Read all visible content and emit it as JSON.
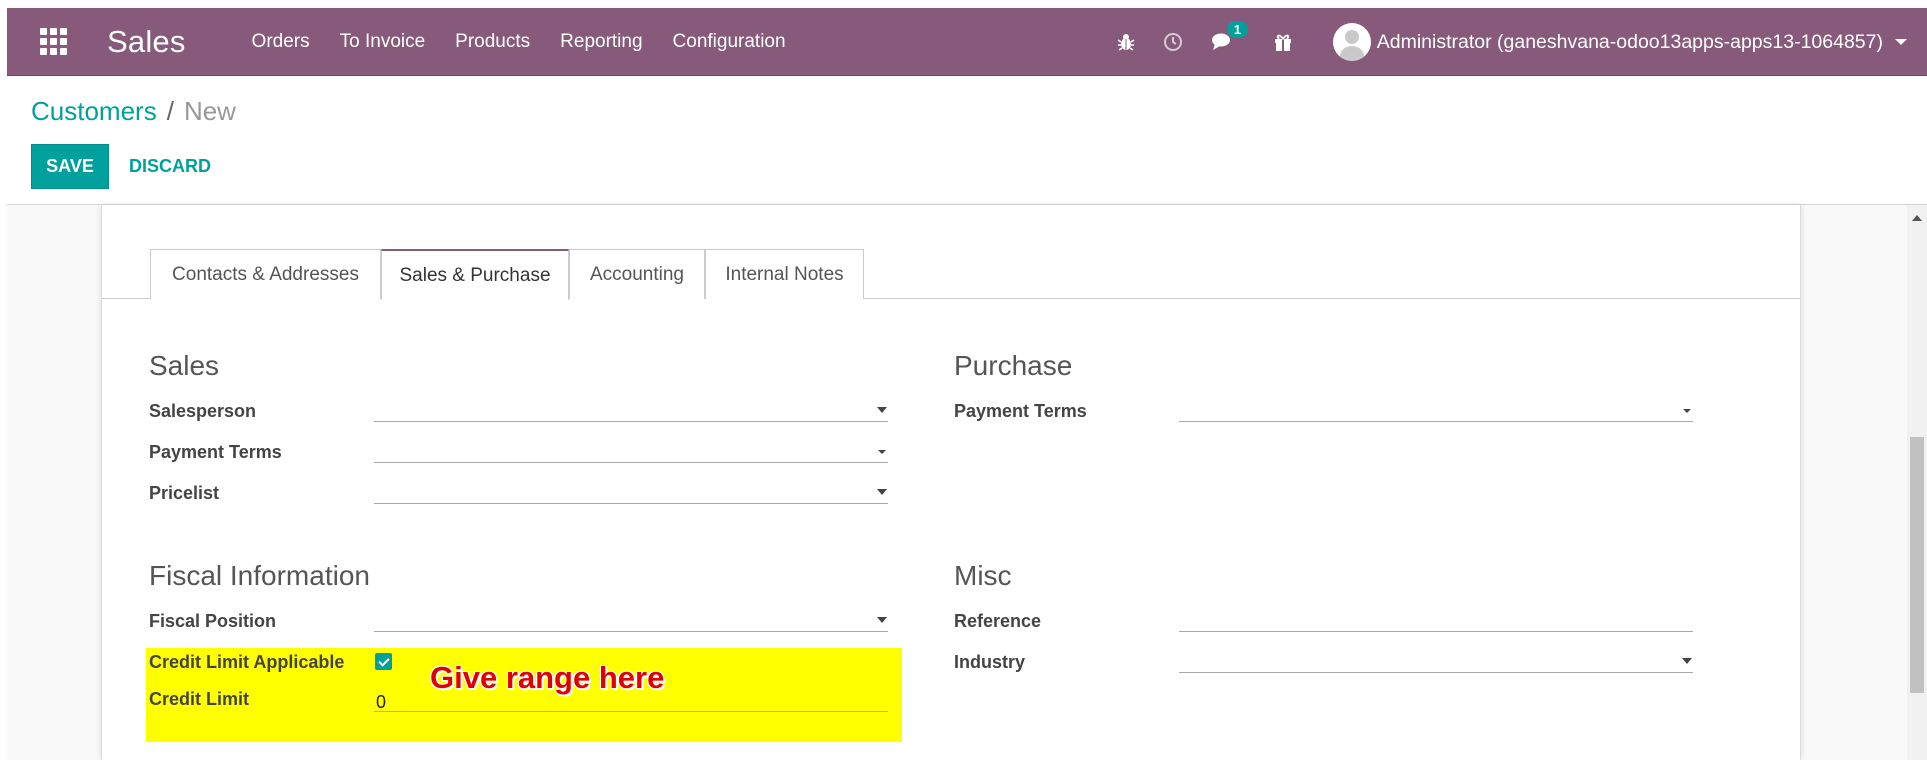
{
  "navbar": {
    "app_name": "Sales",
    "menu": [
      "Orders",
      "To Invoice",
      "Products",
      "Reporting",
      "Configuration"
    ],
    "chat_count": "1",
    "user": "Administrator (ganeshvana-odoo13apps-apps13-1064857)",
    "icons": [
      "apps-grid-icon",
      "bug-icon",
      "clock-icon",
      "chat-icon",
      "gift-icon"
    ]
  },
  "breadcrumb": {
    "parent": "Customers",
    "separator": "/",
    "current": "New"
  },
  "buttons": {
    "save": "SAVE",
    "discard": "DISCARD"
  },
  "tabs": [
    "Contacts & Addresses",
    "Sales & Purchase",
    "Accounting",
    "Internal Notes"
  ],
  "active_tab": "Sales & Purchase",
  "sales": {
    "title": "Sales",
    "salesperson_label": "Salesperson",
    "payment_terms_label": "Payment Terms",
    "pricelist_label": "Pricelist"
  },
  "purchase": {
    "title": "Purchase",
    "payment_terms_label": "Payment Terms"
  },
  "fiscal": {
    "title": "Fiscal Information",
    "fiscal_position_label": "Fiscal Position",
    "credit_limit_applicable_label": "Credit Limit Applicable",
    "credit_limit_applicable": true,
    "credit_limit_label": "Credit Limit",
    "credit_limit_value": "0"
  },
  "misc": {
    "title": "Misc",
    "reference_label": "Reference",
    "industry_label": "Industry"
  },
  "annotation": "Give range here",
  "colors": {
    "navbar": "#875A7B",
    "accent": "#00A09D",
    "highlight": "#ffff00",
    "annotation": "#e00000"
  }
}
